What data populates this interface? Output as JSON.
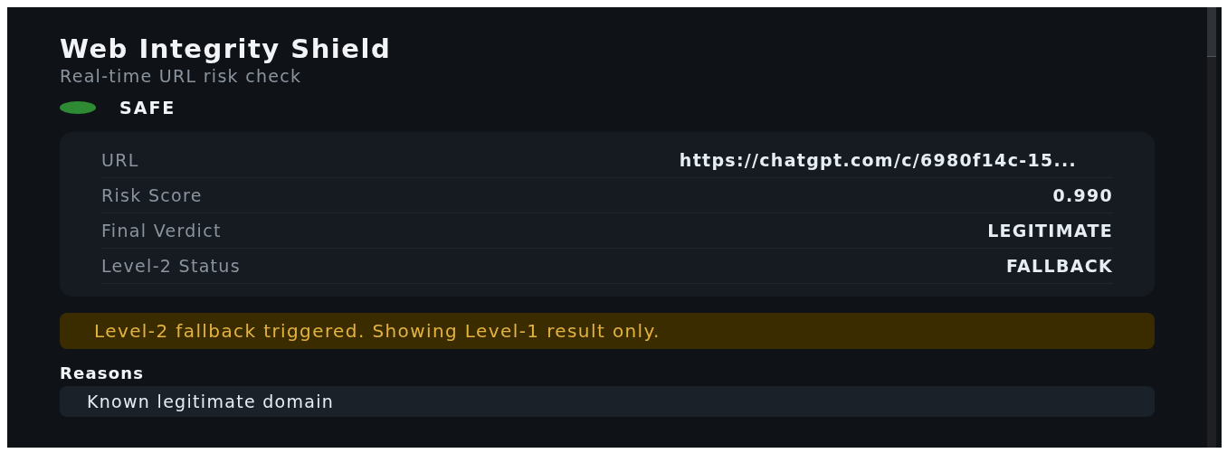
{
  "header": {
    "title": "Web Integrity Shield",
    "subtitle": "Real-time URL risk check"
  },
  "status": {
    "label": "SAFE",
    "color": "#2e8b34"
  },
  "details": [
    {
      "label": "URL",
      "value": "https://chatgpt.com/c/6980f14c-15..."
    },
    {
      "label": "Risk Score",
      "value": "0.990"
    },
    {
      "label": "Final Verdict",
      "value": "LEGITIMATE"
    },
    {
      "label": "Level-2 Status",
      "value": "FALLBACK"
    }
  ],
  "alert": {
    "kind": "warning",
    "text": "Level-2 fallback triggered. Showing Level-1 result only."
  },
  "reasons": {
    "title": "Reasons",
    "items": [
      "Known legitimate domain"
    ]
  }
}
